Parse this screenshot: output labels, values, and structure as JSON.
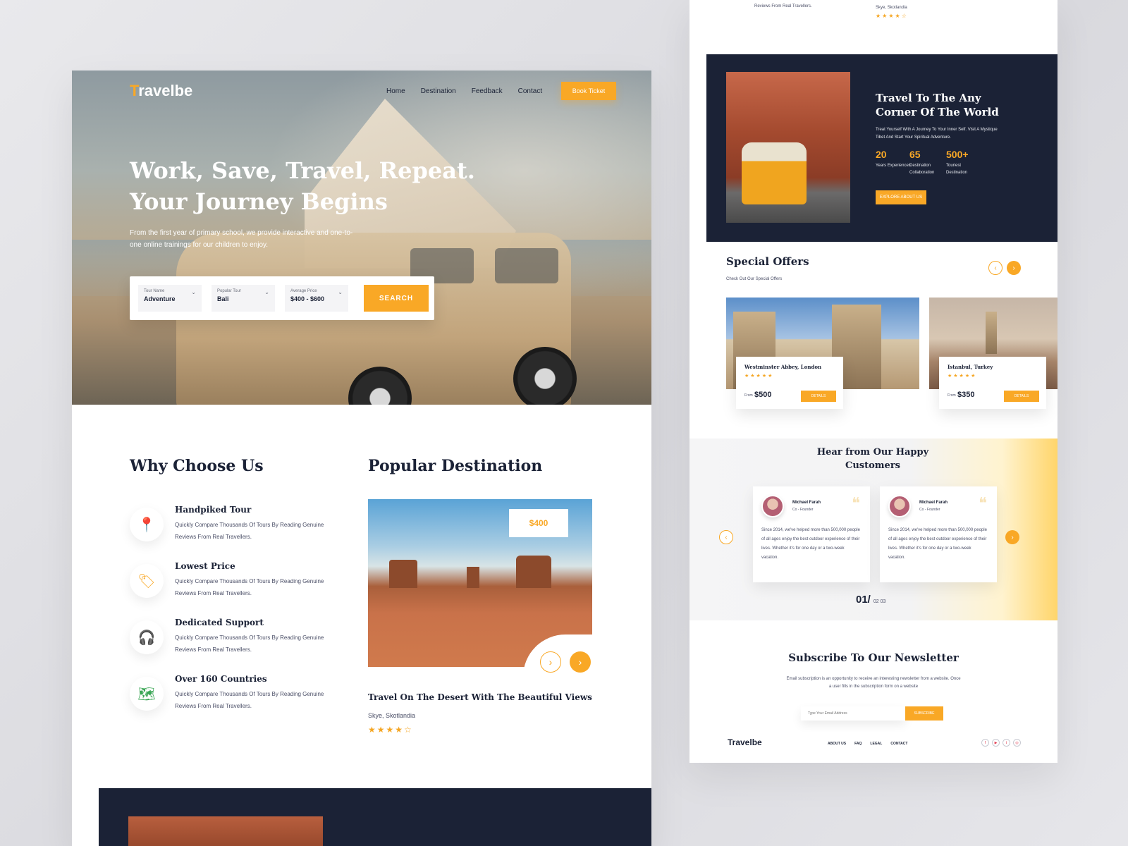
{
  "nav": {
    "logo_accent": "T",
    "logo_rest": "ravelbe",
    "links": [
      "Home",
      "Destination",
      "Feedback",
      "Contact"
    ],
    "cta": "Book Ticket"
  },
  "hero": {
    "title_line1": "Work, Save, Travel, Repeat.",
    "title_line2": "Your Journey Begins",
    "subtitle": "From the first year of primary school, we provide interactive and one-to-one online trainings for our children to enjoy."
  },
  "search": {
    "fields": [
      {
        "label": "Tour Name",
        "value": "Adventure"
      },
      {
        "label": "Popular Tour",
        "value": "Bali"
      },
      {
        "label": "Average Price",
        "value": "$400 - $600"
      }
    ],
    "button": "SEARCH"
  },
  "why": {
    "heading": "Why Choose Us",
    "features": [
      {
        "title": "Handpiked Tour",
        "desc": "Quickly Compare Thousands Of Tours By Reading Genuine Reviews From Real Travellers.",
        "icon": "map-pin-icon"
      },
      {
        "title": "Lowest Price",
        "desc": "Quickly Compare Thousands Of Tours By Reading Genuine Reviews From Real Travellers.",
        "icon": "price-tag-icon"
      },
      {
        "title": "Dedicated Support",
        "desc": "Quickly Compare Thousands Of Tours By Reading Genuine Reviews From Real Travellers.",
        "icon": "support-agent-icon"
      },
      {
        "title": "Over 160 Countries",
        "desc": "Quickly Compare Thousands Of Tours By Reading Genuine Reviews From Real Travellers.",
        "icon": "world-map-icon"
      }
    ]
  },
  "popular": {
    "heading": "Popular Destination",
    "price": "$400",
    "card_title": "Travel On The Desert With The Beautiful Views",
    "location": "Skye, Skotlandia",
    "rating": 4
  },
  "top_snippet": {
    "text": "Reviews From Real Travellers.",
    "location": "Skye, Skotlandia",
    "rating": 4
  },
  "about": {
    "title": "Travel To The Any Corner Of The World",
    "text": "Treat Yourself With A Journey To Your Inner Self. Visit A Mystique Tibet And Start Your Spiritual Adventure.",
    "stats": [
      {
        "value": "20",
        "label": "Years Experiences"
      },
      {
        "value": "65",
        "label": "Destination Collaboration"
      },
      {
        "value": "500+",
        "label": "Touriest Destination"
      }
    ],
    "button": "EXPLORE ABOUT US"
  },
  "offers": {
    "heading": "Special Offers",
    "subtitle": "Check Out Our Special Offers",
    "items": [
      {
        "title": "Westminster Abbey, London",
        "rating": 5,
        "from": "From",
        "price": "$500",
        "button": "DETAILS"
      },
      {
        "title": "Istanbul, Turkey",
        "rating": 5,
        "from": "From",
        "price": "$350",
        "button": "DETAILS"
      }
    ]
  },
  "testimonials": {
    "heading": "Hear from Our Happy Customers",
    "items": [
      {
        "name": "Michael Farah",
        "role": "Co - Founder",
        "text": "Since 2014, we've helped more than 500,000 people of all ages enjoy the best outdoor experience of their lives. Whether it's for one day or a two-week vacation."
      },
      {
        "name": "Michael Farah",
        "role": "Co - Founder",
        "text": "Since 2014, we've helped more than 500,000 people of all ages enjoy the best outdoor experience of their lives. Whether it's for one day or a two-week vacation."
      }
    ],
    "counter_current": "01/",
    "counter_rest": "02 03"
  },
  "newsletter": {
    "heading": "Subscribe To Our Newsletter",
    "text": "Email subscription is an opportunity to receive an interesting newsletter from a website. Once a user fills in the subscription form on a website",
    "placeholder": "Type Your Email Address",
    "button": "SUBSCRIBE"
  },
  "footer": {
    "logo": "Travelbe",
    "links": [
      "ABOUT US",
      "FAQ",
      "LEGAL",
      "CONTACT"
    ],
    "social": [
      "facebook-icon",
      "youtube-icon",
      "twitter-icon",
      "instagram-icon"
    ]
  },
  "colors": {
    "accent": "#f9a826",
    "navy": "#1b2236"
  }
}
